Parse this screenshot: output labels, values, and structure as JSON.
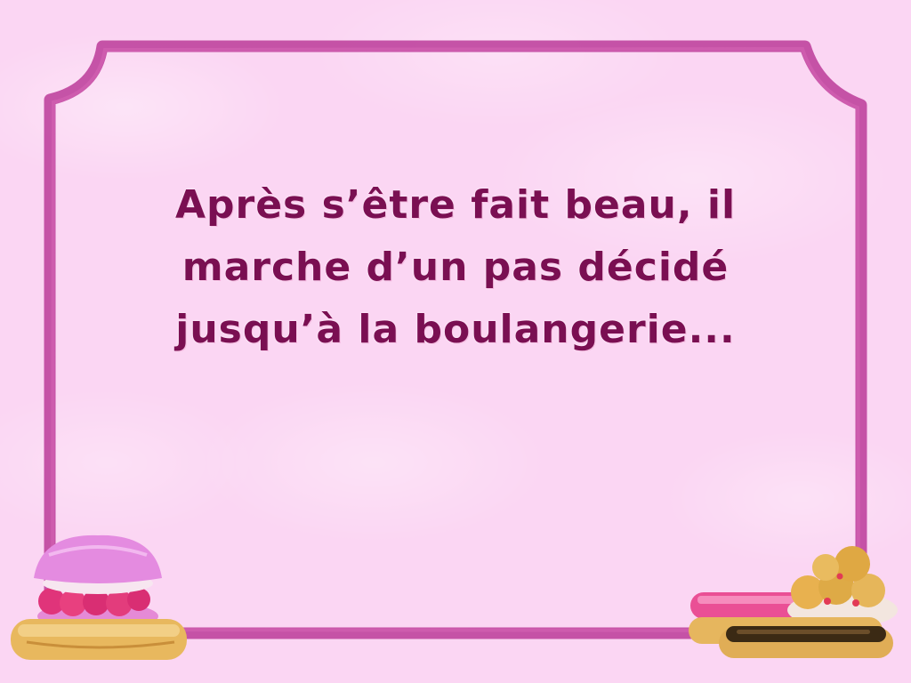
{
  "scene": {
    "caption_lines": [
      "Après s’être fait beau, il",
      "marche d’un pas décidé",
      "jusqu’à la boulangerie..."
    ]
  },
  "colors": {
    "background": "#fbd6f3",
    "frame": "#c0469f",
    "caption_text": "#7a0f52"
  },
  "decorations": {
    "left": [
      "macaron-icon",
      "eclair-icon"
    ],
    "right": [
      "cream-puff-icon",
      "eclair-icon",
      "chocolate-eclair-icon"
    ]
  }
}
